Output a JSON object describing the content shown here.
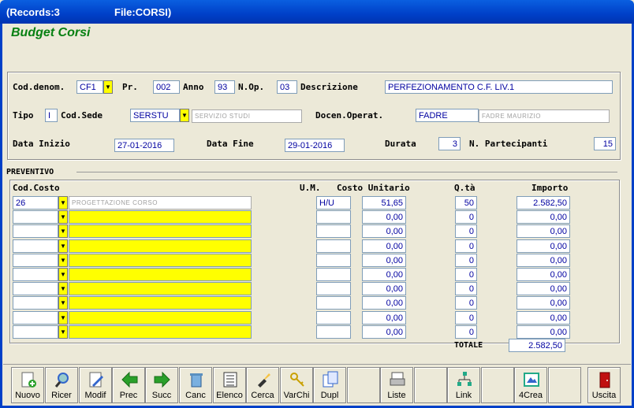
{
  "window": {
    "records": "(Records:3",
    "file": "File:CORSI)"
  },
  "form_title": "Budget Corsi",
  "header": {
    "cod_denom_label": "Cod.denom.",
    "cod_denom_value": "CF1",
    "pr_label": "Pr.",
    "pr_value": "002",
    "anno_label": "Anno",
    "anno_value": "93",
    "nop_label": "N.Op.",
    "nop_value": "03",
    "descrizione_label": "Descrizione",
    "descrizione_value": "PERFEZIONAMENTO C.F. LIV.1",
    "tipo_label": "Tipo",
    "tipo_value": "I",
    "cod_sede_label": "Cod.Sede",
    "cod_sede_value": "SERSTU",
    "cod_sede_desc": "SERVIZIO STUDI",
    "docen_label": "Docen.Operat.",
    "docen_value": "FADRE",
    "docen_desc": "FADRE MAURIZIO",
    "data_inizio_label": "Data Inizio",
    "data_inizio_value": "27-01-2016",
    "data_fine_label": "Data Fine",
    "data_fine_value": "29-01-2016",
    "durata_label": "Durata",
    "durata_value": "3",
    "partecipanti_label": "N. Partecipanti",
    "partecipanti_value": "15"
  },
  "preventivo": {
    "section_label": "PREVENTIVO",
    "col_codcosto": "Cod.Costo",
    "col_um": "U.M.",
    "col_costo": "Costo Unitario",
    "col_qta": "Q.tà",
    "col_importo": "Importo",
    "rows": [
      {
        "cod": "26",
        "desc": "PROGETTAZIONE CORSO",
        "um": "H/U",
        "costo": "51,65",
        "qta": "50",
        "importo": "2.582,50"
      },
      {
        "cod": "",
        "desc": "",
        "um": "",
        "costo": "0,00",
        "qta": "0",
        "importo": "0,00"
      },
      {
        "cod": "",
        "desc": "",
        "um": "",
        "costo": "0,00",
        "qta": "0",
        "importo": "0,00"
      },
      {
        "cod": "",
        "desc": "",
        "um": "",
        "costo": "0,00",
        "qta": "0",
        "importo": "0,00"
      },
      {
        "cod": "",
        "desc": "",
        "um": "",
        "costo": "0,00",
        "qta": "0",
        "importo": "0,00"
      },
      {
        "cod": "",
        "desc": "",
        "um": "",
        "costo": "0,00",
        "qta": "0",
        "importo": "0,00"
      },
      {
        "cod": "",
        "desc": "",
        "um": "",
        "costo": "0,00",
        "qta": "0",
        "importo": "0,00"
      },
      {
        "cod": "",
        "desc": "",
        "um": "",
        "costo": "0,00",
        "qta": "0",
        "importo": "0,00"
      },
      {
        "cod": "",
        "desc": "",
        "um": "",
        "costo": "0,00",
        "qta": "0",
        "importo": "0,00"
      },
      {
        "cod": "",
        "desc": "",
        "um": "",
        "costo": "0,00",
        "qta": "0",
        "importo": "0,00"
      }
    ],
    "totale_label": "TOTALE",
    "totale_value": "2.582,50"
  },
  "toolbar": [
    {
      "label": "Nuovo",
      "icon": "new-record-icon"
    },
    {
      "label": "Ricer",
      "icon": "search-icon"
    },
    {
      "label": "Modif",
      "icon": "edit-icon"
    },
    {
      "label": "Prec",
      "icon": "arrow-left-icon"
    },
    {
      "label": "Succ",
      "icon": "arrow-right-icon"
    },
    {
      "label": "Canc",
      "icon": "trash-icon"
    },
    {
      "label": "Elenco",
      "icon": "list-icon"
    },
    {
      "label": "Cerca",
      "icon": "flashlight-icon"
    },
    {
      "label": "VarChi",
      "icon": "keys-icon"
    },
    {
      "label": "Dupl",
      "icon": "duplicate-icon"
    },
    {
      "label": "",
      "icon": ""
    },
    {
      "label": "Liste",
      "icon": "printer-icon"
    },
    {
      "label": "",
      "icon": ""
    },
    {
      "label": "Link",
      "icon": "link-tree-icon"
    },
    {
      "label": "",
      "icon": ""
    },
    {
      "label": "4Crea",
      "icon": "create-icon"
    },
    {
      "label": "",
      "icon": ""
    },
    {
      "label": "Uscita",
      "icon": "exit-door-icon"
    }
  ]
}
